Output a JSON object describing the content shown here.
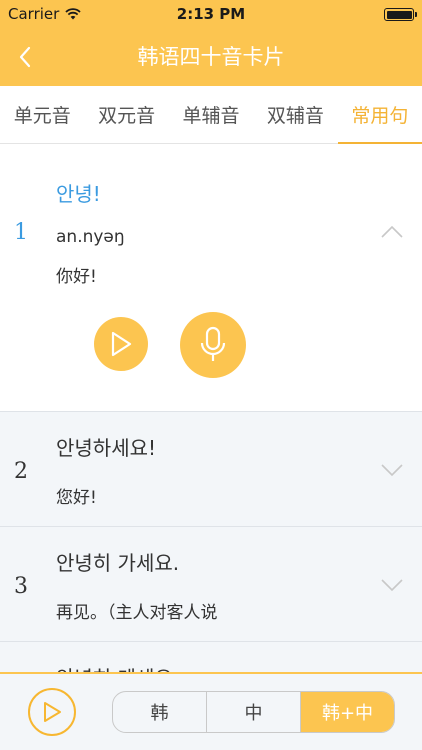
{
  "status": {
    "carrier": "Carrier",
    "time": "2:13 PM"
  },
  "nav": {
    "title": "韩语四十音卡片"
  },
  "tabs": [
    {
      "label": "单元音"
    },
    {
      "label": "双元音"
    },
    {
      "label": "单辅音"
    },
    {
      "label": "双辅音"
    },
    {
      "label": "常用句",
      "active": true
    }
  ],
  "items": [
    {
      "num": "1",
      "kr": "안녕!",
      "rom": "an.nyəŋ",
      "cn": "你好!",
      "expanded": true
    },
    {
      "num": "2",
      "kr": "안녕하세요!",
      "cn": "您好!"
    },
    {
      "num": "3",
      "kr": "안녕히 가세요.",
      "cn": "再见。（主人对客人说"
    },
    {
      "kr": "안녕히 계세요."
    }
  ],
  "bottom": {
    "segments": [
      "韩",
      "中",
      "韩+中"
    ],
    "selected": "韩+中"
  },
  "colors": {
    "accent": "#fcc550",
    "highlight": "#3b9be0",
    "tab_active": "#f4b335"
  }
}
